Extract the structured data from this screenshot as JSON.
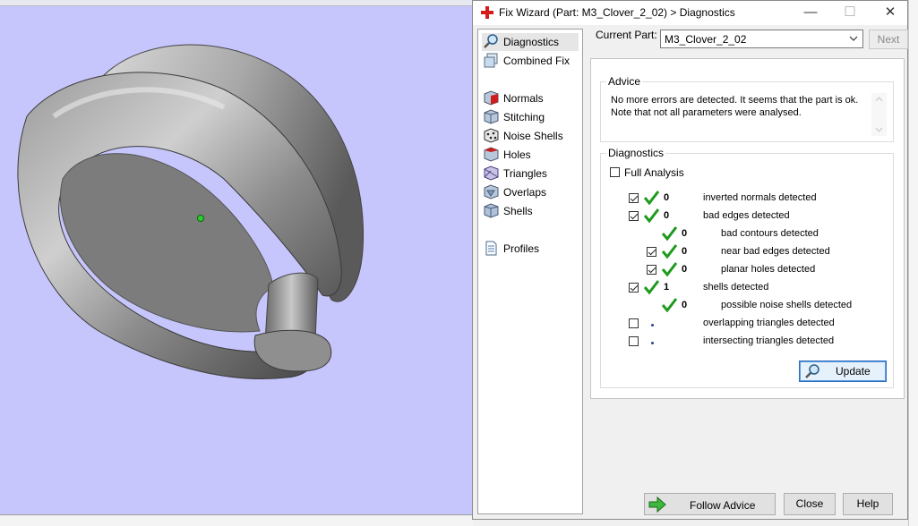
{
  "window": {
    "title": "Fix Wizard (Part: M3_Clover_2_02) > Diagnostics",
    "controls": {
      "minimize": "—",
      "maximize": "☐",
      "close": "✕"
    }
  },
  "nav": {
    "items": [
      {
        "label": "Diagnostics",
        "icon": "magnifier-icon",
        "selected": true
      },
      {
        "label": "Combined Fix",
        "icon": "combined-fix-icon"
      },
      {
        "label": "Normals",
        "icon": "normals-cube-icon"
      },
      {
        "label": "Stitching",
        "icon": "stitching-cube-icon"
      },
      {
        "label": "Noise Shells",
        "icon": "noise-shells-icon"
      },
      {
        "label": "Holes",
        "icon": "holes-cube-icon"
      },
      {
        "label": "Triangles",
        "icon": "triangles-cube-icon"
      },
      {
        "label": "Overlaps",
        "icon": "overlaps-cube-icon"
      },
      {
        "label": "Shells",
        "icon": "shells-cube-icon"
      },
      {
        "label": "Profiles",
        "icon": "document-icon"
      }
    ]
  },
  "current_part": {
    "label": "Current Part:",
    "value": "M3_Clover_2_02",
    "next_label": "Next"
  },
  "advice": {
    "title": "Advice",
    "text": "No more errors are detected. It seems that the part is ok. Note that not all parameters were analysed."
  },
  "diagnostics": {
    "title": "Diagnostics",
    "full_analysis_label": "Full Analysis",
    "full_analysis_checked": false,
    "rows": [
      {
        "checkbox": true,
        "checked": true,
        "ok": true,
        "count": "0",
        "label": "inverted normals detected",
        "indent": 0
      },
      {
        "checkbox": true,
        "checked": true,
        "ok": true,
        "count": "0",
        "label": "bad edges detected",
        "indent": 0
      },
      {
        "checkbox": false,
        "checked": false,
        "ok": true,
        "count": "0",
        "label": "bad contours detected",
        "indent": 1
      },
      {
        "checkbox": true,
        "checked": true,
        "ok": true,
        "count": "0",
        "label": "near bad edges detected",
        "indent": 1
      },
      {
        "checkbox": true,
        "checked": true,
        "ok": true,
        "count": "0",
        "label": "planar holes detected",
        "indent": 1
      },
      {
        "checkbox": true,
        "checked": true,
        "ok": true,
        "count": "1",
        "label": "shells detected",
        "indent": 0
      },
      {
        "checkbox": false,
        "checked": false,
        "ok": true,
        "count": "0",
        "label": "possible noise shells detected",
        "indent": 1
      },
      {
        "checkbox": true,
        "checked": false,
        "ok": false,
        "count": "",
        "label": "overlapping triangles detected",
        "indent": 0
      },
      {
        "checkbox": true,
        "checked": false,
        "ok": false,
        "count": "",
        "label": "intersecting triangles detected",
        "indent": 0
      }
    ],
    "update_label": "Update"
  },
  "footer": {
    "follow_advice": "Follow Advice",
    "close": "Close",
    "help": "Help"
  },
  "colors": {
    "viewport_bg": "#c6c6fc",
    "ok_check": "#1e9a1e",
    "dialog_bg": "#f0f0f0"
  }
}
